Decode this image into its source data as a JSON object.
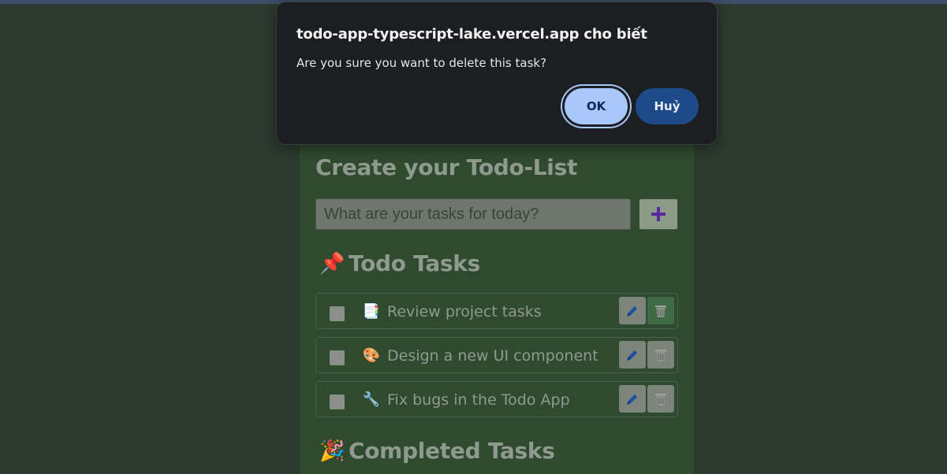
{
  "dialog": {
    "title": "todo-app-typescript-lake.vercel.app cho biết",
    "message": "Are you sure you want to delete this task?",
    "ok_label": "OK",
    "cancel_label": "Huỷ"
  },
  "app": {
    "title": "Create your Todo-List",
    "input_placeholder": "What are your tasks for today?",
    "add_icon": "plus-icon",
    "todo_section": {
      "emoji": "📌",
      "title": "Todo Tasks"
    },
    "completed_section": {
      "emoji": "🎉",
      "title": "Completed Tasks"
    },
    "tasks": [
      {
        "emoji": "📑",
        "text": "Review project tasks",
        "checked": false
      },
      {
        "emoji": "🎨",
        "text": "Design a new UI component",
        "checked": false
      },
      {
        "emoji": "🔧",
        "text": "Fix bugs in the Todo App",
        "checked": false
      }
    ]
  },
  "colors": {
    "page_bg": "#2c3b2e",
    "dialog_bg": "#1c1e22",
    "ok_button": "#a8c7fa",
    "cancel_button": "#1f4a8a",
    "plus_icon": "#5b2aa0",
    "edit_icon": "#1e4fa8"
  }
}
